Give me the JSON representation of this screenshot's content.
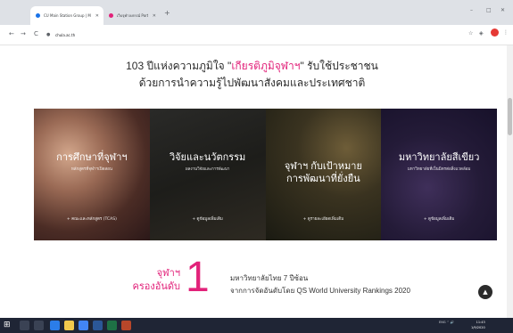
{
  "browser": {
    "tabs": [
      {
        "title": "CU Main Station Group | Main",
        "active": true,
        "favicon_color": "#1a73e8"
      },
      {
        "title": "เว็บจุฬาลงกรณ์ Portfolio",
        "active": false,
        "favicon_color": "#e2227a"
      }
    ],
    "url": "chula.ac.th",
    "new_tab": "+",
    "min": "–",
    "max": "□",
    "close": "✕",
    "back": "←",
    "forward": "→",
    "reload": "C",
    "menu": "⋮"
  },
  "page": {
    "headline_line1_pre": "103 ปีแห่งความภูมิใจ \"",
    "headline_line1_hl": "เกียรติภูมิจุฬาฯ",
    "headline_line1_post": "\" รับใช้ประชาชน",
    "headline_line2": "ด้วยการนำความรู้ไปพัฒนาสังคมและประเทศชาติ",
    "accent": "#e2227a",
    "cards": [
      {
        "title": "การศึกษาที่จุฬาฯ",
        "subtitle": "หลักสูตรที่จุฬาฯเปิดสอน",
        "cta": "+ คณะและหลักสูตร (TCAS)"
      },
      {
        "title": "วิจัยและนวัตกรรม",
        "subtitle": "ผลงานวิจัยและการพัฒนา",
        "cta": "+ ดูข้อมูลเพิ่มเติม"
      },
      {
        "title": "จุฬาฯ กับเป้าหมาย\nการพัฒนาที่ยั่งยืน",
        "subtitle": "",
        "cta": "+ ดูรายละเอียดเพิ่มเติม"
      },
      {
        "title": "มหาวิทยาลัยสีเขียว",
        "subtitle": "มหาวิทยาลัยที่เป็นมิตรต่อสิ่งแวดล้อม",
        "cta": "+ ดูข้อมูลเพิ่มเติม"
      }
    ],
    "rank_left_line1": "จุฬาฯ",
    "rank_left_line2": "ครองอันดับ",
    "rank_number": "1",
    "rank_right_line1": "มหาวิทยาลัยไทย 7 ปีซ้อน",
    "rank_right_line2": "จากการจัดอันดับโดย QS World University Rankings 2020",
    "scroll_top": "▲"
  },
  "taskbar": {
    "start": "⊞",
    "tray": "ENG ⌃ 🔊",
    "time": "11:43",
    "date": "1/9/2020"
  }
}
